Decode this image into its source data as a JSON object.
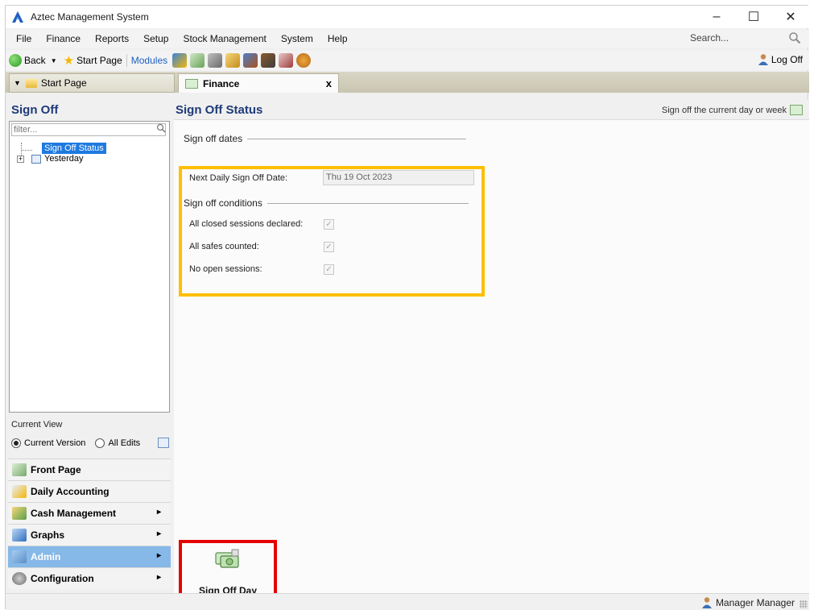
{
  "window": {
    "title": "Aztec Management System"
  },
  "menu": {
    "items": [
      "File",
      "Finance",
      "Reports",
      "Setup",
      "Stock Management",
      "System",
      "Help"
    ],
    "search_label": "Search..."
  },
  "toolbar": {
    "back_label": "Back",
    "start_page_label": "Start Page",
    "modules_label": "Modules",
    "logoff_label": "Log Off"
  },
  "tabs": [
    {
      "label": "Start Page"
    },
    {
      "label": "Finance",
      "close": "x"
    }
  ],
  "left_pane": {
    "title": "Sign Off",
    "filter_placeholder": "filter...",
    "tree": [
      {
        "label": "Sign Off Status",
        "selected": true
      },
      {
        "label": "Yesterday",
        "expander": "+"
      }
    ],
    "current_view": {
      "label": "Current View",
      "option_current": "Current Version",
      "option_all": "All Edits",
      "selected": "Current Version"
    },
    "nav": [
      {
        "label": "Front Page",
        "chevron": ""
      },
      {
        "label": "Daily Accounting",
        "chevron": ""
      },
      {
        "label": "Cash Management",
        "chevron": "▸"
      },
      {
        "label": "Graphs",
        "chevron": "▸"
      },
      {
        "label": "Admin",
        "chevron": "▸",
        "active": true
      },
      {
        "label": "Configuration",
        "chevron": "▸"
      }
    ]
  },
  "right_pane": {
    "title": "Sign Off Status",
    "action_link": "Sign off the current day or week",
    "sections": {
      "dates_heading": "Sign off dates",
      "next_date_label": "Next Daily Sign Off Date:",
      "next_date_value": "Thu 19 Oct 2023",
      "conditions_heading": "Sign off conditions",
      "conditions": [
        {
          "label": "All closed sessions declared:",
          "checked": true
        },
        {
          "label": "All safes counted:",
          "checked": true
        },
        {
          "label": "No open sessions:",
          "checked": true
        }
      ]
    },
    "sign_off_button": "Sign Off Day"
  },
  "status_bar": {
    "user": "Manager Manager"
  },
  "colors": {
    "title_blue": "#1e3a78",
    "highlight_yellow": "#ffbf00",
    "highlight_red": "#e60000",
    "nav_active": "#86b8e8",
    "tree_selection": "#1f7ae0"
  }
}
